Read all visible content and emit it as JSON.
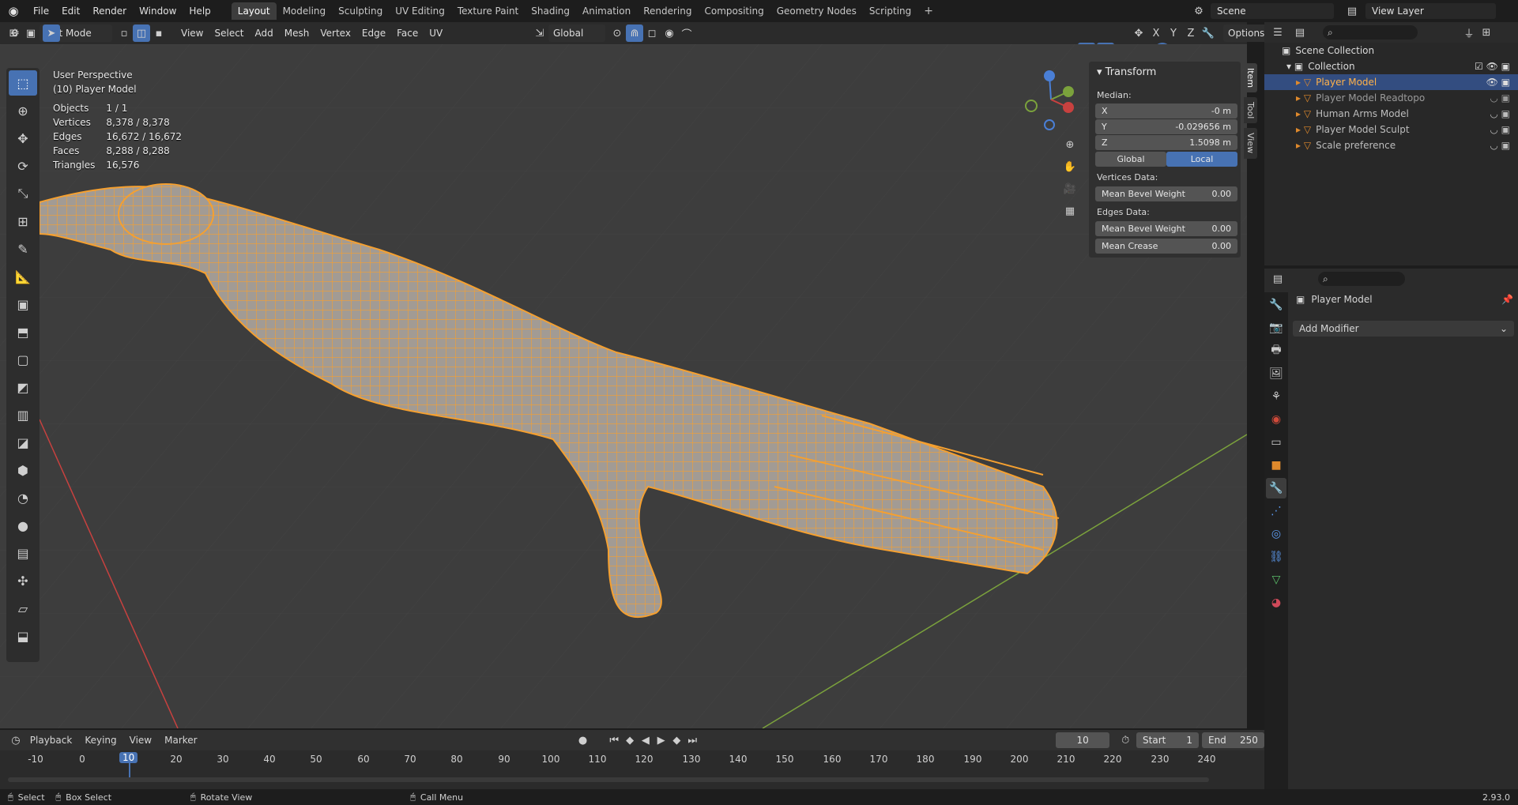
{
  "topbar": {
    "menus": [
      "File",
      "Edit",
      "Render",
      "Window",
      "Help"
    ],
    "workspaces": [
      "Layout",
      "Modeling",
      "Sculpting",
      "UV Editing",
      "Texture Paint",
      "Shading",
      "Animation",
      "Rendering",
      "Compositing",
      "Geometry Nodes",
      "Scripting"
    ],
    "active_workspace": "Layout",
    "add_tab": "+",
    "scene": "Scene",
    "view_layer": "View Layer"
  },
  "viewport_header": {
    "mode": "Edit Mode",
    "menus": [
      "View",
      "Select",
      "Add",
      "Mesh",
      "Vertex",
      "Edge",
      "Face",
      "UV"
    ],
    "orientation": "Global",
    "options": "Options",
    "axes": [
      "X",
      "Y",
      "Z"
    ]
  },
  "overlay": {
    "perspective": "User Perspective",
    "object": "(10)  Player Model",
    "stats": [
      {
        "label": "Objects",
        "value": "1 / 1"
      },
      {
        "label": "Vertices",
        "value": "8,378 / 8,378"
      },
      {
        "label": "Edges",
        "value": "16,672 / 16,672"
      },
      {
        "label": "Faces",
        "value": "8,288 / 8,288"
      },
      {
        "label": "Triangles",
        "value": "16,576"
      }
    ]
  },
  "npanel": {
    "title": "Transform",
    "median": "Median:",
    "x_label": "X",
    "x_value": "-0 m",
    "y_label": "Y",
    "y_value": "-0.029656 m",
    "z_label": "Z",
    "z_value": "1.5098 m",
    "global": "Global",
    "local": "Local",
    "vertices_data": "Vertices Data:",
    "v_bevel_label": "Mean Bevel Weight",
    "v_bevel_value": "0.00",
    "edges_data": "Edges Data:",
    "e_bevel_label": "Mean Bevel Weight",
    "e_bevel_value": "0.00",
    "crease_label": "Mean Crease",
    "crease_value": "0.00",
    "tabs": [
      "Item",
      "Tool",
      "View"
    ]
  },
  "outliner": {
    "scene_collection": "Scene Collection",
    "collection": "Collection",
    "items": [
      "Player Model",
      "Player Model Readtopo",
      "Human Arms Model",
      "Player Model Sculpt",
      "Scale preference"
    ]
  },
  "properties": {
    "object_name": "Player Model",
    "add_modifier": "Add Modifier"
  },
  "timeline": {
    "menus": [
      "Playback",
      "Keying",
      "View",
      "Marker"
    ],
    "current_frame": "10",
    "start_label": "Start",
    "start": "1",
    "end_label": "End",
    "end": "250",
    "ticks": [
      "-10",
      "0",
      "10",
      "20",
      "30",
      "40",
      "50",
      "60",
      "70",
      "80",
      "90",
      "100",
      "110",
      "120",
      "130",
      "140",
      "150",
      "160",
      "170",
      "180",
      "190",
      "200",
      "210",
      "220",
      "230",
      "240"
    ]
  },
  "status": {
    "select": "Select",
    "box_select": "Box Select",
    "rotate": "Rotate View",
    "call_menu": "Call Menu",
    "version": "2.93.0"
  },
  "colors": {
    "accent": "#4772b3",
    "mesh": "#f5a030",
    "grid_x": "#c8413f",
    "grid_y": "#7ba23c"
  }
}
